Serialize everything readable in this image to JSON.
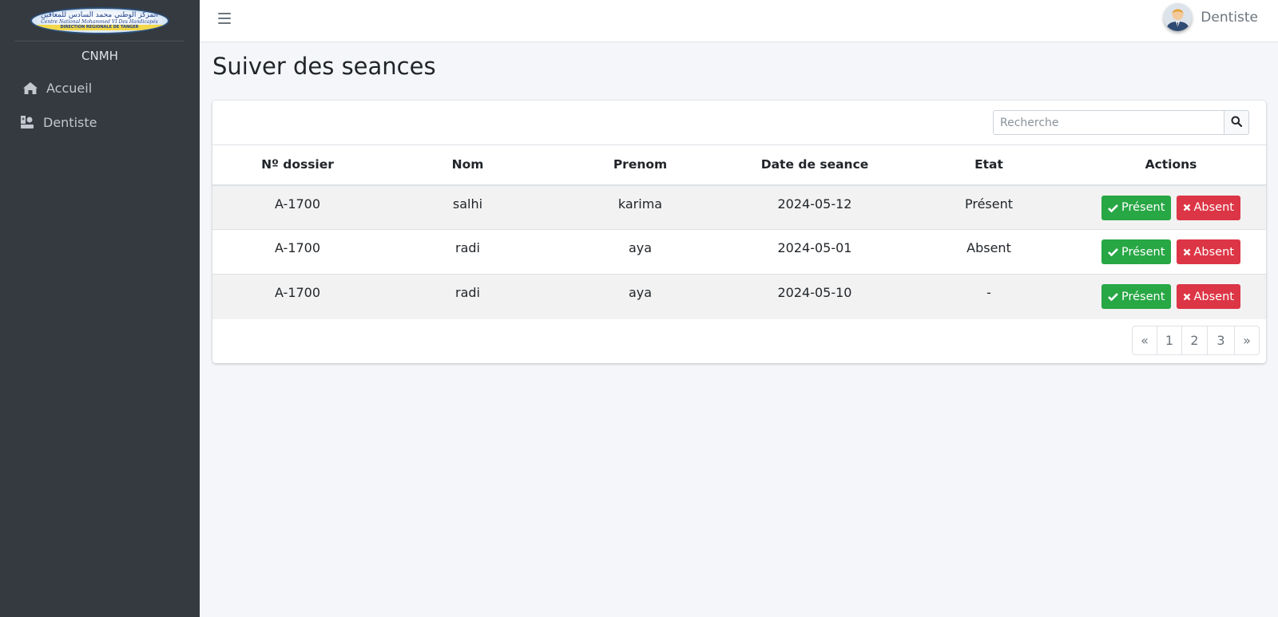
{
  "sidebar": {
    "logo": {
      "line1": "المركز الوطني محمد السادس للمعاقين",
      "line2": "Centre National Mohammed VI Des Handicapés",
      "line3": "DIRECTION REGIONALE DE TANGER"
    },
    "brand": "CNMH",
    "items": [
      {
        "label": "Accueil",
        "icon": "home-icon"
      },
      {
        "label": "Dentiste",
        "icon": "user-doctor-icon"
      }
    ]
  },
  "topbar": {
    "user_name": "Dentiste"
  },
  "page": {
    "title": "Suiver des seances"
  },
  "search": {
    "placeholder": "Recherche"
  },
  "table": {
    "headers": [
      "Nº dossier",
      "Nom",
      "Prenom",
      "Date de seance",
      "Etat",
      "Actions"
    ],
    "rows": [
      {
        "dossier": "A-1700",
        "nom": "salhi",
        "prenom": "karima",
        "date": "2024-05-12",
        "etat": "Présent"
      },
      {
        "dossier": "A-1700",
        "nom": "radi",
        "prenom": "aya",
        "date": "2024-05-01",
        "etat": "Absent"
      },
      {
        "dossier": "A-1700",
        "nom": "radi",
        "prenom": "aya",
        "date": "2024-05-10",
        "etat": "-"
      }
    ],
    "present_label": "Présent",
    "absent_label": "Absent"
  },
  "pagination": {
    "prev": "«",
    "pages": [
      "1",
      "2",
      "3"
    ],
    "next": "»"
  },
  "colors": {
    "sidebar_bg": "#343a40",
    "success": "#28a745",
    "danger": "#dc3545",
    "page_bg": "#f4f6f9"
  }
}
